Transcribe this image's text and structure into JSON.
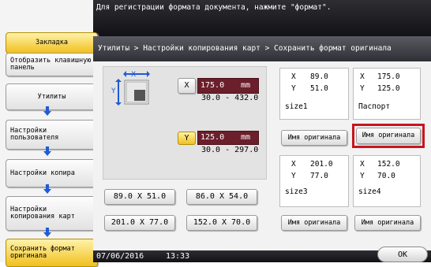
{
  "message": "Для регистрации формата документа, нажмите \"формат\".",
  "sidebar": {
    "bookmark": "Закладка",
    "keypad": "Отобразить клавишную панель",
    "steps": [
      "Утилиты",
      "Настройки пользователя",
      "Настройки копира",
      "Настройки копирования карт",
      "Сохранить формат оригинала"
    ]
  },
  "breadcrumb": "Утилиты > Настройки копирования карт > Сохранить формат оригинала",
  "x_field": {
    "label": "X",
    "value": "175.0",
    "unit": "mm",
    "range": "30.0  -  432.0"
  },
  "y_field": {
    "label": "Y",
    "value": "125.0",
    "unit": "mm",
    "range": "30.0  -  297.0"
  },
  "presets": [
    "89.0 X 51.0",
    "86.0 X 54.0",
    "201.0 X 77.0",
    "152.0 X 70.0"
  ],
  "slots": [
    {
      "x": "89.0",
      "y": "51.0",
      "name": "size1",
      "button": "Имя оригинала"
    },
    {
      "x": "175.0",
      "y": "125.0",
      "name": "Паспорт",
      "button": "Имя оригинала"
    },
    {
      "x": "201.0",
      "y": "77.0",
      "name": "size3",
      "button": "Имя оригинала"
    },
    {
      "x": "152.0",
      "y": "70.0",
      "name": "size4",
      "button": "Имя оригинала"
    }
  ],
  "slot_axis": {
    "x": "X",
    "y": "Y"
  },
  "status": {
    "date": "07/06/2016",
    "time": "13:33"
  },
  "ok_label": "OK",
  "icons": {
    "arrows": "arrow-down-icon",
    "document": "document-size-icon"
  },
  "colors": {
    "value_box": "#6b1f2b",
    "highlight": "#c8141e",
    "accent": "#f0c020"
  }
}
